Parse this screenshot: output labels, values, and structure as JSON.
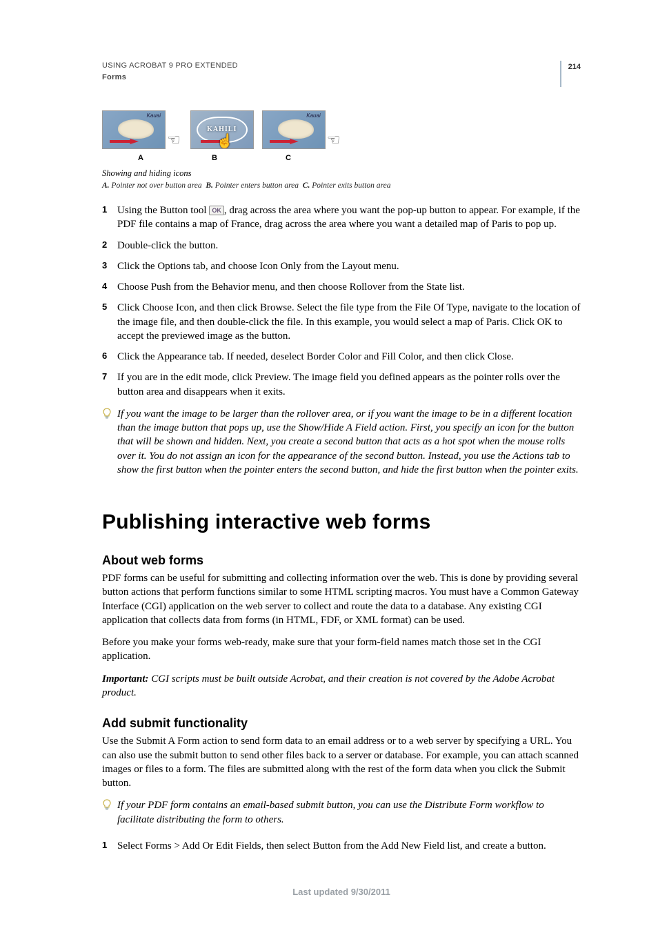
{
  "header": {
    "product": "USING ACROBAT 9 PRO EXTENDED",
    "section": "Forms",
    "page_number": "214"
  },
  "figure": {
    "labels": {
      "a": "A",
      "b": "B",
      "c": "C"
    },
    "map_label": "Kauai",
    "badge_text": "KAHILI",
    "caption": "Showing and hiding icons",
    "legend": {
      "a_bold": "A.",
      "a_text": "Pointer not over button area",
      "b_bold": "B.",
      "b_text": "Pointer enters button area",
      "c_bold": "C.",
      "c_text": "Pointer exits button area"
    }
  },
  "steps_a": [
    {
      "pre": "Using the Button tool ",
      "ok_label": "OK",
      "post": ", drag across the area where you want the pop-up button to appear. For example, if the PDF file contains a map of France, drag across the area where you want a detailed map of Paris to pop up."
    },
    {
      "text": "Double-click the button."
    },
    {
      "text": "Click the Options tab, and choose Icon Only from the Layout menu."
    },
    {
      "text": "Choose Push from the Behavior menu, and then choose Rollover from the State list."
    },
    {
      "text": "Click Choose Icon, and then click Browse. Select the file type from the File Of Type, navigate to the location of the image file, and then double-click the file. In this example, you would select a map of Paris. Click OK to accept the previewed image as the button."
    },
    {
      "text": "Click the Appearance tab. If needed, deselect Border Color and Fill Color, and then click Close."
    },
    {
      "text": "If you are in the edit mode, click Preview. The image field you defined appears as the pointer rolls over the button area and disappears when it exits."
    }
  ],
  "tip_a": "If you want the image to be larger than the rollover area, or if you want the image to be in a different location than the image button that pops up, use the Show/Hide A Field action. First, you specify an icon for the button that will be shown and hidden. Next, you create a second button that acts as a hot spot when the mouse rolls over it. You do not assign an icon for the appearance of the second button. Instead, you use the Actions tab to show the first button when the pointer enters the second button, and hide the first button when the pointer exits.",
  "h1": "Publishing interactive web forms",
  "about": {
    "heading": "About web forms",
    "p1": "PDF forms can be useful for submitting and collecting information over the web. This is done by providing several button actions that perform functions similar to some HTML scripting macros. You must have a Common Gateway Interface (CGI) application on the web server to collect and route the data to a database. Any existing CGI application that collects data from forms (in HTML, FDF, or XML format) can be used.",
    "p2": "Before you make your forms web-ready, make sure that your form-field names match those set in the CGI application.",
    "important_label": "Important:",
    "important_text": " CGI scripts must be built outside Acrobat, and their creation is not covered by the Adobe Acrobat product."
  },
  "submit": {
    "heading": "Add submit functionality",
    "p1": "Use the Submit A Form action to send form data to an email address or to a web server by specifying a URL. You can also use the submit button to send other files back to a server or database. For example, you can attach scanned images or files to a form. The files are submitted along with the rest of the form data when you click the Submit button.",
    "tip": "If your PDF form contains an email-based submit button, you can use the Distribute Form workflow to facilitate distributing the form to others.",
    "step1": "Select Forms > Add Or Edit Fields, then select Button from the Add New Field list, and create a button."
  },
  "footer": "Last updated 9/30/2011"
}
